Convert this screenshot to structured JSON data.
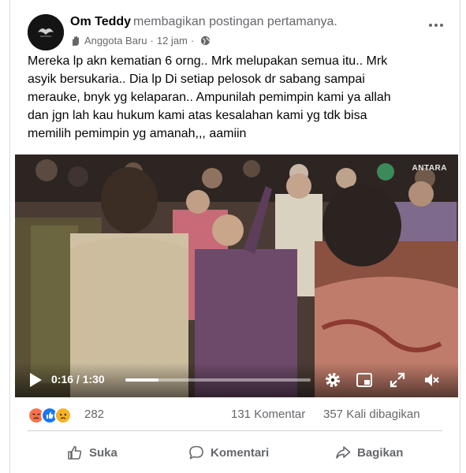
{
  "post": {
    "author": "Om Teddy",
    "action": "membagikan postingan pertamanya.",
    "badge": "Anggota Baru",
    "time": "12 jam",
    "separator": "·",
    "text": "Mereka lp akn kematian 6 orng.. Mrk melupakan semua itu.. Mrk\nasyik bersukaria.. Dia lp Di setiap pelosok dr sabang sampai\nmerauke, bnyk yg kelaparan.. Ampunilah pemimpin kami ya allah\ndan jgn lah kau hukum kami atas kesalahan kami yg tdk bisa\nmemilih pemimpin yg amanah,,, aamiin"
  },
  "video": {
    "watermark": "ANTARA",
    "current_time": "0:16",
    "duration": "1:30",
    "time_display": "0:16 / 1:30",
    "progress": 0.178
  },
  "stats": {
    "reactions": [
      "angry",
      "like",
      "sad"
    ],
    "reaction_count": "282",
    "comments": "131 Komentar",
    "shares": "357 Kali dibagikan"
  },
  "actions": {
    "like": "Suka",
    "comment": "Komentari",
    "share": "Bagikan"
  },
  "colors": {
    "secondary_text": "#65676b",
    "like_blue": "#1877f2",
    "angry_orange": "#f7714c",
    "sad_yellow": "#f7b125"
  }
}
